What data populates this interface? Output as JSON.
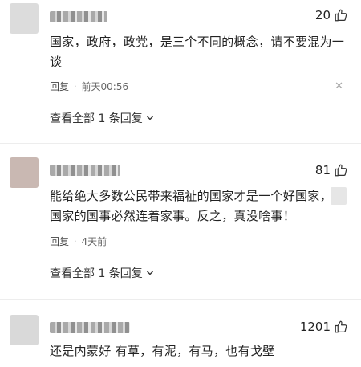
{
  "comments": [
    {
      "avatar_color": "#dcdcdc",
      "likes": "20",
      "text": "国家，政府，政党，是三个不同的概念，请不要混为一谈",
      "reply_label": "回复",
      "time": "前天00:56",
      "view_all": "查看全部 1 条回复"
    },
    {
      "avatar_color": "#c9b8b2",
      "likes": "81",
      "text_line1": "能给绝大多数公民带来福祉的国家才是一个好国家，",
      "text_line2": "国家的国事必然连着家事。反之，真没啥事！",
      "reply_label": "回复",
      "time": "4天前",
      "view_all": "查看全部 1 条回复"
    },
    {
      "avatar_color": "#d9d9d9",
      "likes": "1201",
      "text": "还是内蒙好 有草，有泥，有马，也有戈壁"
    }
  ],
  "colors": {
    "text": "#222222",
    "meta": "#666666",
    "icon": "#333333"
  }
}
